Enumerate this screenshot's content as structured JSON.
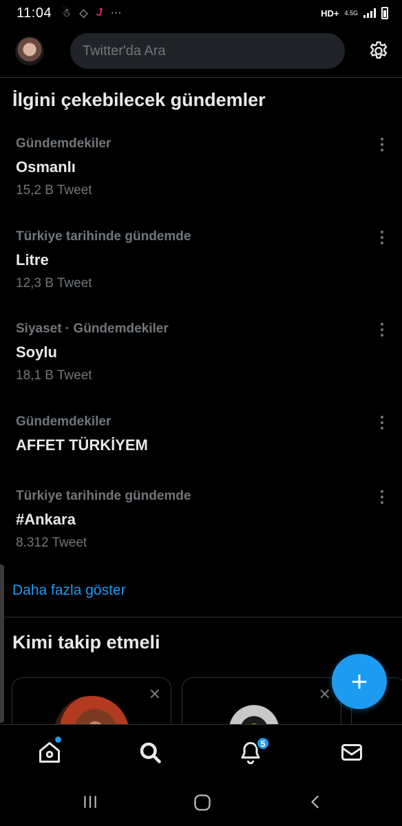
{
  "status_bar": {
    "time": "11:04",
    "network": "HD+",
    "network_type": "4.5G",
    "notif_icons": [
      "snapchat-icon",
      "tinder-icon",
      "tiktok-icon"
    ],
    "more": "···"
  },
  "header": {
    "search_placeholder": "Twitter'da Ara"
  },
  "trends_section": {
    "title": "İlgini çekebilecek gündemler",
    "items": [
      {
        "category": "Gündemdekiler",
        "name": "Osmanlı",
        "count": "15,2 B Tweet"
      },
      {
        "category": "Türkiye tarihinde gündemde",
        "name": "Litre",
        "count": "12,3 B Tweet"
      },
      {
        "category": "Siyaset · Gündemdekiler",
        "name": "Soylu",
        "count": "18,1 B Tweet"
      },
      {
        "category": "Gündemdekiler",
        "name": "AFFET TÜRKİYEM",
        "count": ""
      },
      {
        "category": "Türkiye tarihinde gündemde",
        "name": "#Ankara",
        "count": "8.312 Tweet"
      }
    ],
    "show_more": "Daha fazla göster"
  },
  "follow_section": {
    "title": "Kimi takip etmeli",
    "close_glyph": "✕"
  },
  "fab": {
    "label": "+"
  },
  "tabbar": {
    "notifications_badge": "5"
  },
  "colors": {
    "accent": "#1d9bf0",
    "background": "#000000",
    "muted": "#71767b",
    "text": "#e7e9ea"
  }
}
